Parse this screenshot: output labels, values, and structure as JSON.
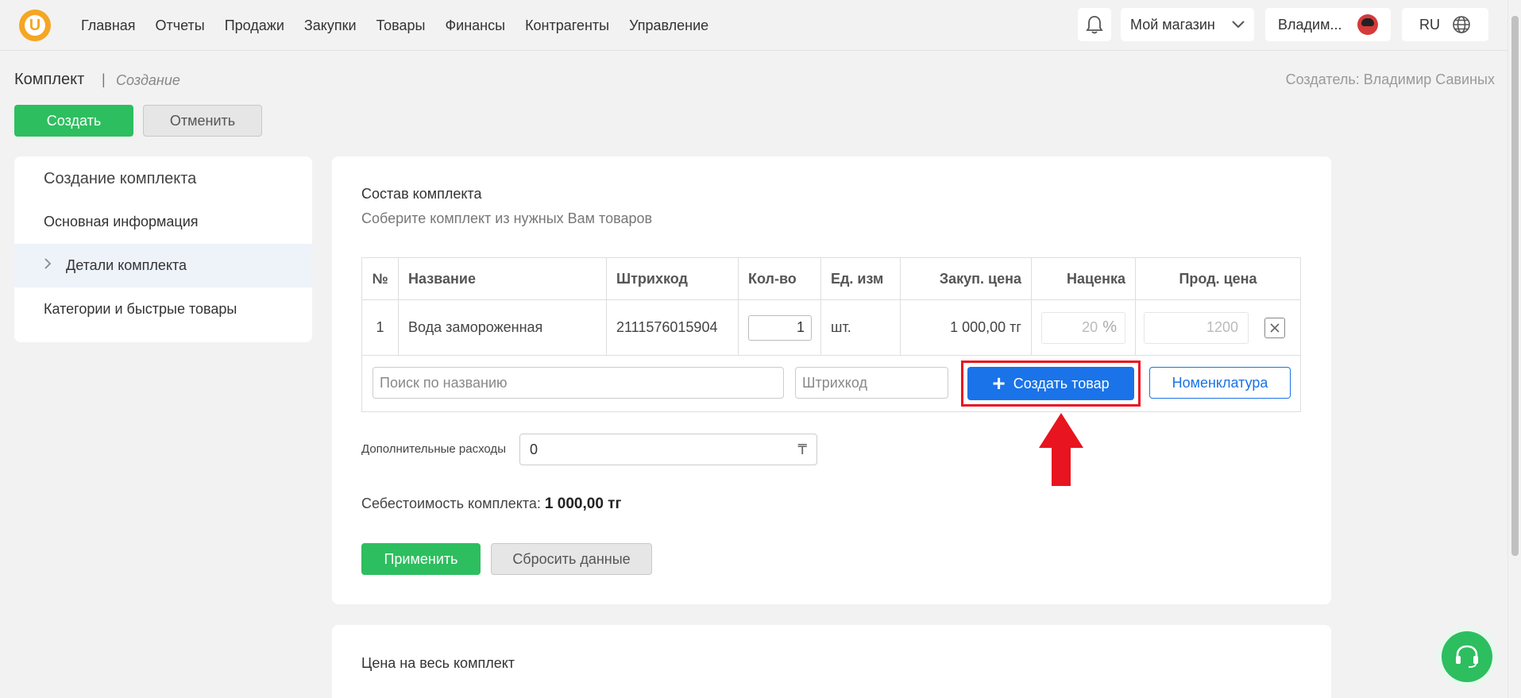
{
  "header": {
    "logo_letter": "U",
    "nav": [
      "Главная",
      "Отчеты",
      "Продажи",
      "Закупки",
      "Товары",
      "Финансы",
      "Контрагенты",
      "Управление"
    ],
    "store": "Мой магазин",
    "user": "Владим...",
    "lang": "RU"
  },
  "page": {
    "title": "Комплект",
    "separator": "|",
    "subtitle": "Создание",
    "creator_label": "Создатель:",
    "creator_name": "Владимир Савиных",
    "create_btn": "Создать",
    "cancel_btn": "Отменить"
  },
  "sidebar": {
    "title": "Создание комплекта",
    "items": [
      "Основная информация",
      "Детали комплекта",
      "Категории и быстрые товары"
    ]
  },
  "kit": {
    "title": "Состав комплекта",
    "subtitle": "Соберите комплект из нужных Вам товаров",
    "columns": [
      "№",
      "Название",
      "Штрихкод",
      "Кол-во",
      "Ед. изм",
      "Закуп. цена",
      "Наценка",
      "Прод. цена"
    ],
    "rows": [
      {
        "num": "1",
        "name": "Вода замороженная",
        "barcode": "2111576015904",
        "qty": "1",
        "unit": "шт.",
        "purchase": "1 000,00 тг",
        "markup": "20",
        "markup_unit": "%",
        "sale": "1200"
      }
    ],
    "search_placeholder": "Поиск по названию",
    "barcode_placeholder": "Штрихкод",
    "create_product_btn": "Создать товар",
    "nomenclature_btn": "Номенклатура",
    "extra_label": "Дополнительные расходы",
    "extra_value": "0",
    "currency_symbol": "₸",
    "cost_label": "Себестоимость комплекта:",
    "cost_value": "1 000,00 тг",
    "apply_btn": "Применить",
    "reset_btn": "Сбросить данные"
  },
  "price_section": {
    "title": "Цена на весь комплект"
  },
  "colors": {
    "accent_green": "#2dbe5f",
    "accent_blue": "#1a73e8",
    "highlight_red": "#e8141f",
    "logo_orange": "#f5a623"
  }
}
